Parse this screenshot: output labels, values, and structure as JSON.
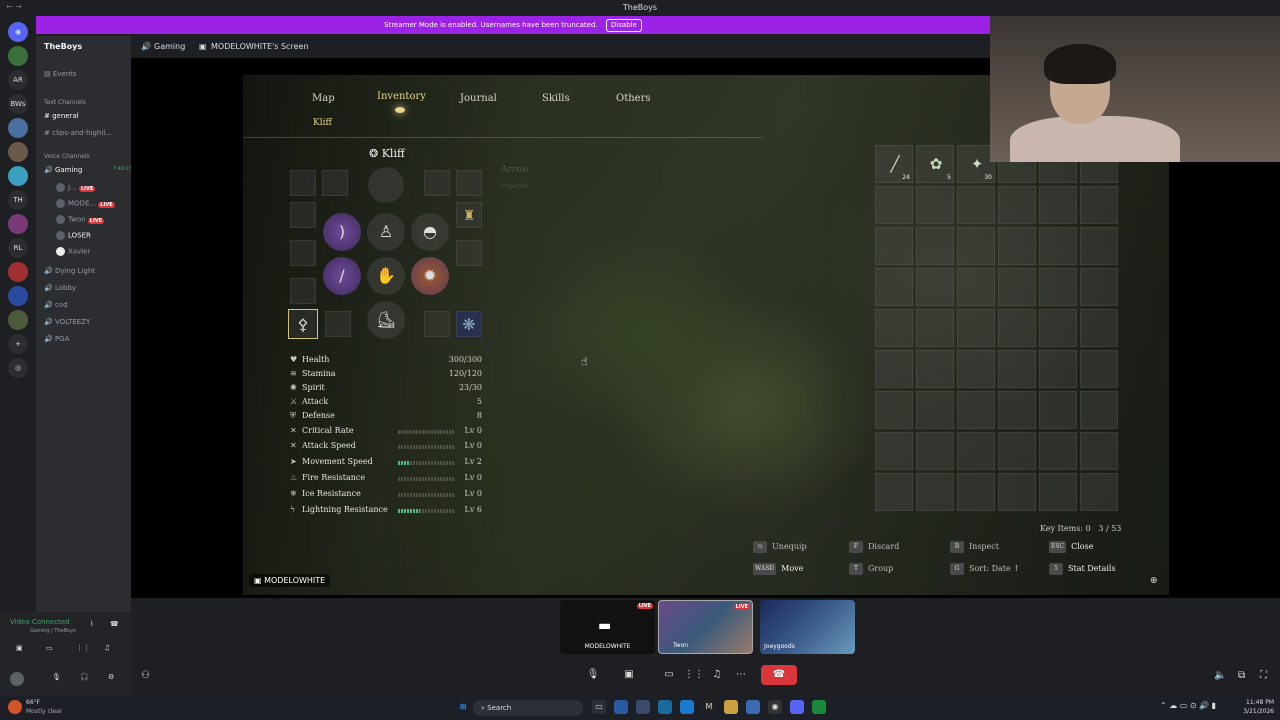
{
  "window": {
    "title": "TheBoys",
    "nav_arrows": "← →"
  },
  "banner": {
    "text": "Streamer Mode is enabled. Usernames have been truncated.",
    "button": "Disable",
    "color": "#9c22e5"
  },
  "servers": [
    "AR",
    "BWs",
    "TH",
    "RL"
  ],
  "sidebar": {
    "server_name": "TheBoys",
    "events": "Events",
    "text_category": "Text Channels",
    "text_channels": [
      "general",
      "clips-and-highli..."
    ],
    "voice_category": "Voice Channels",
    "voice_active": {
      "name": "Gaming",
      "timer": "7:40:23"
    },
    "voice_users": [
      {
        "name": "J...",
        "live": "LIVE"
      },
      {
        "name": "MODE...",
        "live": "LIVE"
      },
      {
        "name": "Twon",
        "live": "LIVE"
      },
      {
        "name": "LOSER",
        "live": ""
      },
      {
        "name": "Xavier",
        "live": ""
      }
    ],
    "voice_channels": [
      "Dying Light",
      "Lobby",
      "cod",
      "VOLTEEZY",
      "PGA"
    ]
  },
  "userpanel": {
    "status": "Video Connected",
    "sub": "Gaming / TheBoys"
  },
  "main_header": {
    "channel": "Gaming",
    "screen": "MODELOWHITE's Screen"
  },
  "game": {
    "tabs": [
      "Map",
      "Inventory",
      "Journal",
      "Skills",
      "Others"
    ],
    "active_tab": "Inventory",
    "subtab": "Kliff",
    "character": "Kliff",
    "faded_item_title": "Arrow",
    "faded_item_sub": "Projectile",
    "stats": [
      {
        "icon": "♥",
        "label": "Health",
        "value": "300/300"
      },
      {
        "icon": "≋",
        "label": "Stamina",
        "value": "120/120"
      },
      {
        "icon": "✺",
        "label": "Spirit",
        "value": "23/30"
      },
      {
        "icon": "⚔",
        "label": "Attack",
        "value": "5"
      },
      {
        "icon": "⛨",
        "label": "Defense",
        "value": "8"
      },
      {
        "icon": "✕",
        "label": "Critical Rate",
        "value": "Lv 0",
        "level": 0
      },
      {
        "icon": "✕",
        "label": "Attack Speed",
        "value": "Lv 0",
        "level": 0
      },
      {
        "icon": "➤",
        "label": "Movement Speed",
        "value": "Lv 2",
        "level": 0.2
      },
      {
        "icon": "♨",
        "label": "Fire Resistance",
        "value": "Lv 0",
        "level": 0
      },
      {
        "icon": "❄",
        "label": "Ice Resistance",
        "value": "Lv 0",
        "level": 0
      },
      {
        "icon": "ϟ",
        "label": "Lightning Resistance",
        "value": "Lv 6",
        "level": 0.4
      }
    ],
    "inventory": [
      {
        "icon": "╱",
        "count": "24"
      },
      {
        "icon": "✿",
        "count": "5"
      },
      {
        "icon": "✦",
        "count": "30"
      }
    ],
    "key_items": "Key Items: 0",
    "capacity": "3 / 53",
    "hints": [
      {
        "key": "⇆",
        "label": "Unequip"
      },
      {
        "key": "F",
        "label": "Discard"
      },
      {
        "key": "R",
        "label": "Inspect"
      },
      {
        "key": "ESC",
        "label": "Close"
      },
      {
        "key": "WASD",
        "label": "Move"
      },
      {
        "key": "T",
        "label": "Group"
      },
      {
        "key": "G",
        "label": "Sort: Date ↑"
      },
      {
        "key": "5",
        "label": "Stat Details"
      }
    ],
    "streamer": "MODELOWHITE"
  },
  "tiles": [
    {
      "label": "MODELOWHITE",
      "live": "LIVE"
    },
    {
      "label": "Twon",
      "live": "LIVE"
    },
    {
      "label": "Joeygoods",
      "live": ""
    }
  ],
  "taskbar": {
    "search": "Search",
    "weather": "66°F",
    "weather_sub": "Mostly clear",
    "time": "11:48 PM",
    "date": "3/21/2026"
  }
}
